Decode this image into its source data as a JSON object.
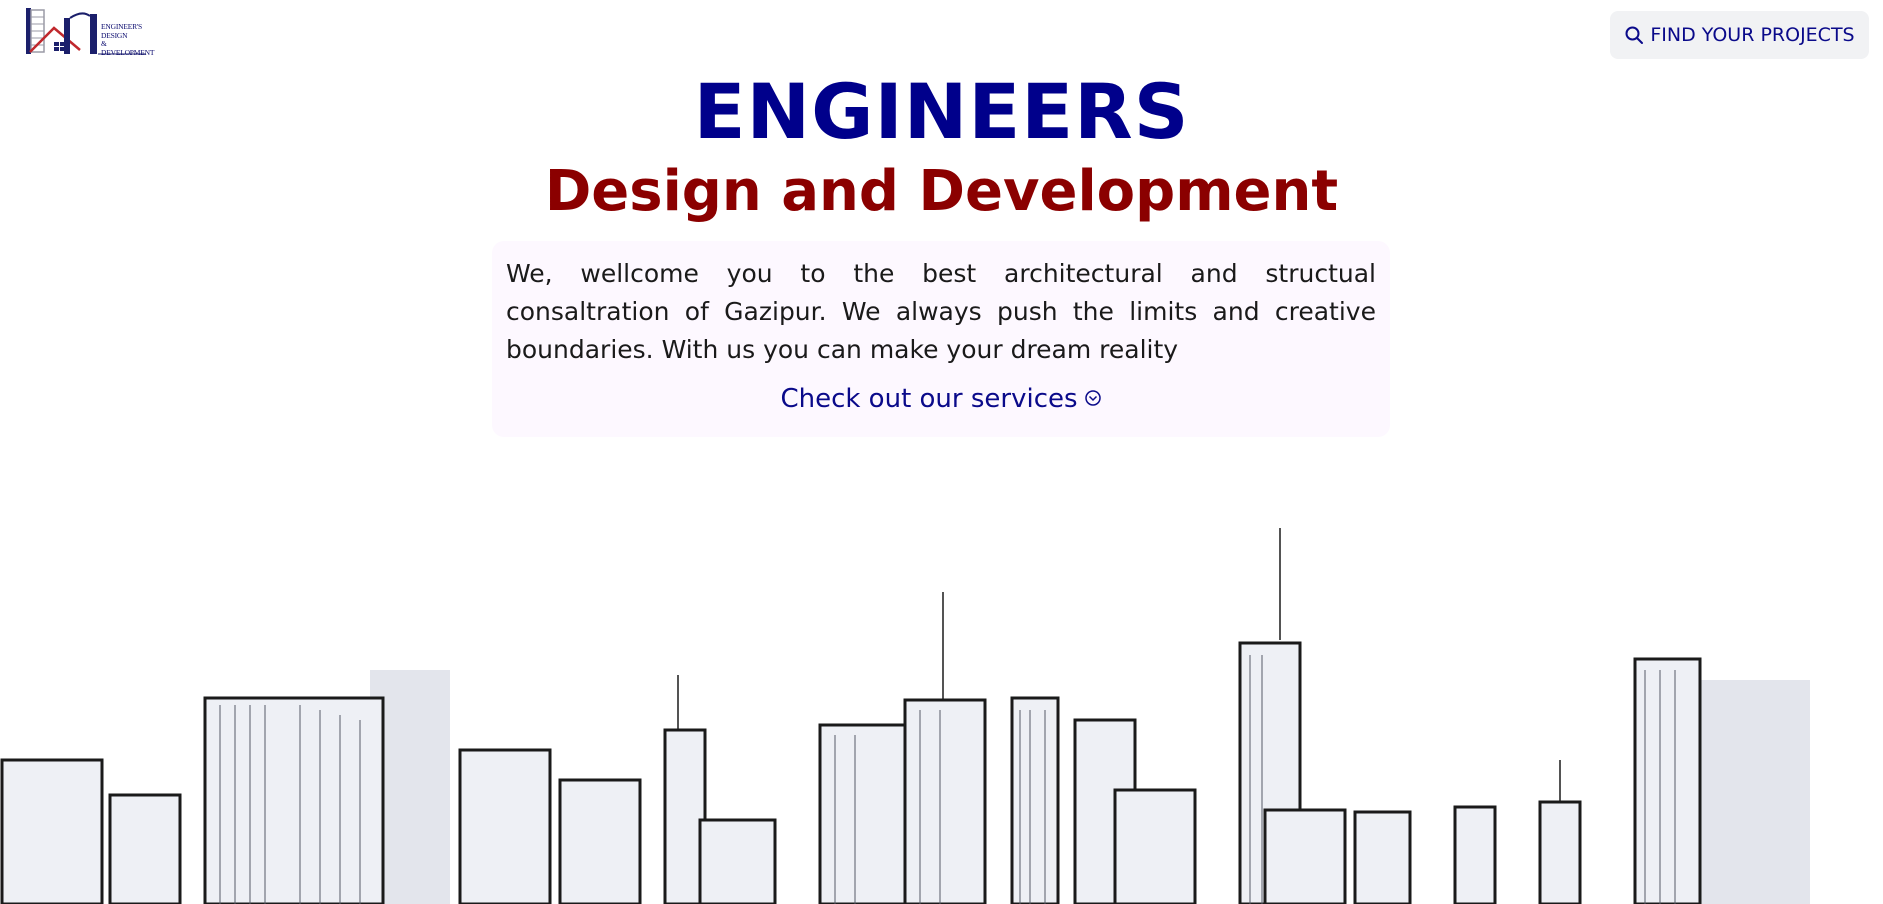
{
  "header": {
    "logo_lines": [
      "ENGINEER'S",
      "DESIGN",
      "&",
      "DEVELOPMENT"
    ],
    "find_button": {
      "label": "FIND YOUR PROJECTS",
      "icon": "search-icon"
    }
  },
  "hero": {
    "title": "ENGINEERS",
    "subtitle": "Design and Development",
    "intro": "We, wellcome you to the best architectural and structual consaltration of Gazipur. We always push the limits and creative boundaries. With us you can make your dream reality",
    "services_link": {
      "label": "Check out our services",
      "icon": "chevron-down-circle-icon"
    }
  },
  "colors": {
    "title": "#00008b",
    "subtitle": "#8b0000",
    "link": "#0a0a8a",
    "intro_bg": "#fdf8ff",
    "button_bg": "#f1f2f4"
  },
  "illustration": {
    "name": "city-skyline-sketch"
  }
}
